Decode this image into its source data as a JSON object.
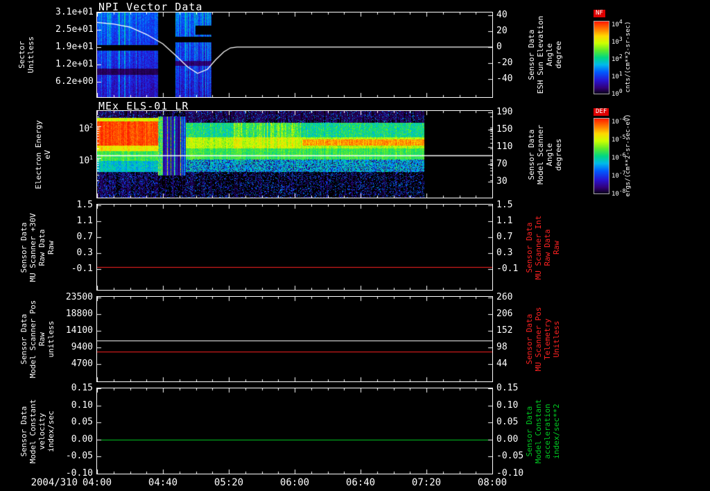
{
  "panels": [
    {
      "title": "NPI Vector Data",
      "left_label": "Sector\nUnitless",
      "right_label": "Sensor Data\nESH Sun Elevation\nAngle\ndegree",
      "right_label_color": "#ffffff",
      "left_ticks": [
        "3.1e+01",
        "2.5e+01",
        "1.9e+01",
        "1.2e+01",
        "6.2e+00"
      ],
      "right_ticks": [
        "40",
        "20",
        "0",
        "-20",
        "-40"
      ]
    },
    {
      "title": "MEx ELS-01 LR",
      "left_label": "Electron Energy\neV",
      "right_label": "Sensor Data\nModel Scanner\nAngle\ndegrees",
      "right_label_color": "#ffffff",
      "left_ticks": [
        "10^2",
        "10^1"
      ],
      "left_ticks_pow": true,
      "right_ticks": [
        "190",
        "150",
        "110",
        "70",
        "30"
      ]
    },
    {
      "left_label": "Sensor Data\nMU Scanner +30V\nRaw Data\nRaw",
      "right_label": "Sensor Data\nMU Scanner Int\nRaw Data\nRaw",
      "right_label_color": "#ff2222",
      "left_ticks": [
        "1.5",
        "1.1",
        "0.7",
        "0.3",
        "-0.1"
      ],
      "right_ticks": [
        "1.5",
        "1.1",
        "0.7",
        "0.3",
        "-0.1"
      ]
    },
    {
      "left_label": "Sensor Data\nModel Scanner Pos\nRaw\nunitless",
      "right_label": "Sensor Data\nMU Scanner Pos\nTelemetry\nUnitless",
      "right_label_color": "#ff2222",
      "left_ticks": [
        "23500",
        "18800",
        "14100",
        "9400",
        "4700"
      ],
      "right_ticks": [
        "260",
        "206",
        "152",
        "98",
        "44"
      ]
    },
    {
      "left_label": "Sensor Data\nModel Constant\nvelocity\nindex/sec",
      "right_label": "Sensor Data\nModel Constant\nacceleration\nindex/sec**2",
      "right_label_color": "#00cc22",
      "left_ticks": [
        "0.15",
        "0.10",
        "0.05",
        "0.00",
        "-0.05",
        "-0.10"
      ],
      "right_ticks": [
        "0.15",
        "0.10",
        "0.05",
        "0.00",
        "-0.05",
        "-0.10"
      ]
    }
  ],
  "x_axis": {
    "date": "2004/310",
    "tick_labels": [
      "04:00",
      "04:40",
      "05:20",
      "06:00",
      "06:40",
      "07:20",
      "08:00"
    ]
  },
  "colorbars": [
    {
      "tag": "NF",
      "units": "cnts/(cm**2-sr-sec)",
      "tick_labels": [
        "10^4",
        "10^3",
        "10^2",
        "10^1",
        "10^0"
      ]
    },
    {
      "tag": "DEF",
      "units": "ergs/(cm**2-sr-sec-eV)",
      "tick_labels": [
        "10^-4",
        "10^-5",
        "10^-6",
        "10^-7",
        "10^-8"
      ]
    }
  ],
  "chart_data": [
    {
      "type": "heatmap",
      "title": "NPI Vector Data",
      "x_span": [
        "2004/310 04:00",
        "2004/310 08:00"
      ],
      "ylabel": "Sector (Unitless)",
      "y_ticks": [
        "3.1e+01",
        "2.5e+01",
        "1.9e+01",
        "1.2e+01",
        "6.2e+00"
      ],
      "colorbar": {
        "tag": "NF",
        "units": "cnts/(cm**2-sr-sec)"
      },
      "coverage_note": "sector spectrogram present only ~04:00-05:10 with a data gap ~04:37-04:47; values low (blue/purple) with cyan streaks and black dropout rows",
      "blocks_xfrac": [
        [
          0.0,
          0.155
        ],
        [
          0.198,
          0.29
        ]
      ],
      "overlay_line": {
        "name": "ESH Sun Elevation Angle (degree)",
        "axis": "right",
        "color": "#ffffff",
        "x_minutes": [
          0,
          10,
          20,
          30,
          40,
          48,
          55,
          61,
          67,
          72,
          77,
          81,
          85,
          100,
          240
        ],
        "values": [
          31,
          29,
          25,
          16,
          4,
          -11,
          -25,
          -33,
          -28,
          -16,
          -6,
          -1,
          0,
          0,
          0
        ]
      }
    },
    {
      "type": "heatmap",
      "title": "MEx ELS-01 LR",
      "ylabel": "Electron Energy (eV)",
      "yscale": "log",
      "y_ticks": [
        "10^2",
        "10^1"
      ],
      "x_span": [
        "04:00",
        "07:20"
      ],
      "colorbar": {
        "tag": "DEF",
        "units": "ergs/(cm**2-sr-sec-eV)"
      },
      "data_xfrac": [
        0.0,
        0.828
      ],
      "features": [
        "intense red flux band ~15-80 eV from 04:00 to ~04:38",
        "striped dropout interval ~04:38-04:55",
        "continuous yellow-green band ~20-50 eV out to 07:20",
        "orange enhancement near 30 eV after ~06:05",
        "sparse blue/purple speckle at lowest energies"
      ],
      "overlay_line": {
        "name": "Model Scanner Angle (degrees)",
        "axis": "right",
        "color": "#ffffff",
        "constant_value": 90
      }
    },
    {
      "type": "line",
      "y_ticks": [
        1.5,
        1.1,
        0.7,
        0.3,
        -0.1
      ],
      "series": [
        {
          "name": "MU Scanner Int Raw Data Raw",
          "axis": "right",
          "color": "#ff2222",
          "constant_value": -0.05
        }
      ]
    },
    {
      "type": "line",
      "left_ticks": [
        23500,
        18800,
        14100,
        9400,
        4700
      ],
      "right_ticks": [
        260,
        206,
        152,
        98,
        44
      ],
      "series": [
        {
          "name": "Model Scanner Pos Raw (unitless)",
          "axis": "left",
          "color": "#ffffff",
          "constant_value": 11500
        },
        {
          "name": "MU Scanner Pos Telemetry (Unitless)",
          "axis": "right",
          "color": "#ff2222",
          "constant_value": 86
        }
      ]
    },
    {
      "type": "line",
      "y_ticks": [
        0.15,
        0.1,
        0.05,
        0.0,
        -0.05,
        -0.1
      ],
      "series": [
        {
          "name": "Model Constant acceleration (index/sec**2)",
          "axis": "left",
          "color": "#00cc22",
          "constant_value": 0.0
        }
      ]
    }
  ]
}
